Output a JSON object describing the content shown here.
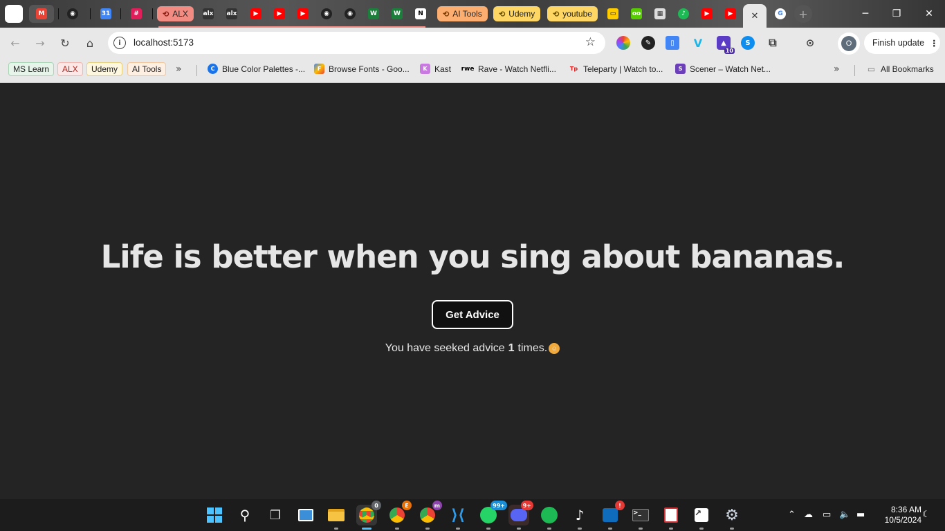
{
  "browser": {
    "tab_groups": [
      {
        "label": "ALX",
        "color": "#f28b82"
      },
      {
        "label": "AI Tools",
        "color": "#fcad70"
      },
      {
        "label": "Udemy",
        "color": "#fdd663"
      },
      {
        "label": "youtube",
        "color": "#fdd663"
      }
    ],
    "address": "localhost:5173",
    "finish_update_label": "Finish update",
    "profile_initial": "O",
    "extension_badge": "10",
    "bookmarks": {
      "chips": [
        {
          "label": "MS Learn",
          "color": "#e6f4ea"
        },
        {
          "label": "ALX",
          "color": "#fce8e6"
        },
        {
          "label": "Udemy",
          "color": "#fef7e0"
        },
        {
          "label": "AI Tools",
          "color": "#feefe3"
        }
      ],
      "items": [
        {
          "label": "Blue Color Palettes -..."
        },
        {
          "label": "Browse Fonts - Goo..."
        },
        {
          "label": "Kast"
        },
        {
          "label": "Rave - Watch Netfli..."
        },
        {
          "label": "Teleparty | Watch to..."
        },
        {
          "label": "Scener – Watch Net..."
        }
      ],
      "all_bookmarks": "All Bookmarks"
    }
  },
  "page": {
    "advice_text": "Life is better when you sing about bananas.",
    "button_label": "Get Advice",
    "counter_prefix": "You have seeked advice",
    "counter_value": "1",
    "counter_suffix": "times."
  },
  "taskbar": {
    "badges": {
      "chrome_profile_1": "0",
      "chrome_profile_2": "E",
      "chrome_profile_3": "m",
      "whatsapp": "99+",
      "discord": "9+",
      "alert": "!"
    },
    "time": "8:36 AM",
    "date": "10/5/2024"
  }
}
